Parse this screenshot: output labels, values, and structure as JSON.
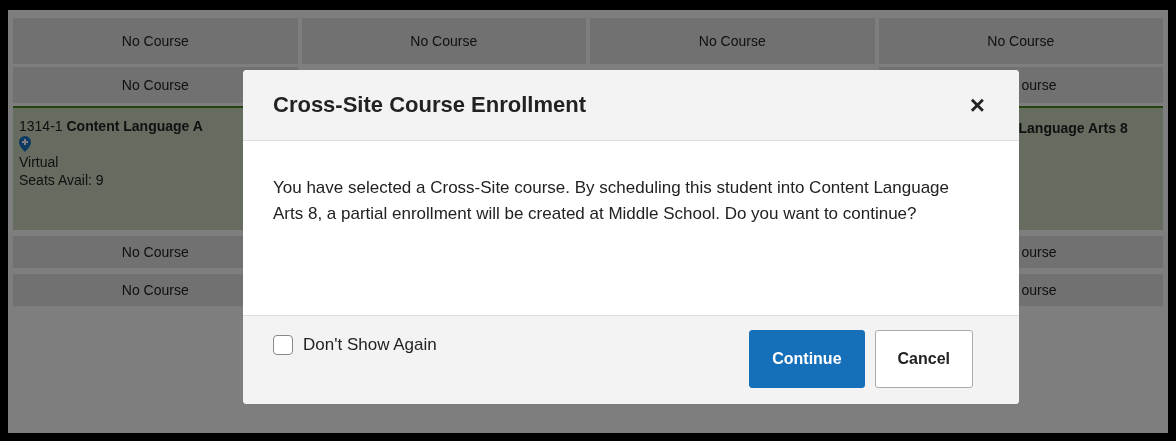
{
  "schedule": {
    "rows": [
      {
        "cells": [
          {
            "kind": "empty",
            "text": "No Course"
          },
          {
            "kind": "empty",
            "text": "No Course"
          },
          {
            "kind": "empty",
            "text": "No Course"
          },
          {
            "kind": "empty",
            "text": "No Course"
          }
        ]
      },
      {
        "cells": [
          {
            "kind": "empty",
            "text": "No Course"
          },
          null,
          null,
          {
            "kind": "cut",
            "text": "ourse"
          }
        ]
      },
      {
        "cells": [
          {
            "kind": "course",
            "code": "1314-1",
            "name": "Content Language A",
            "location": "Virtual",
            "seats": "Seats Avail: 9"
          },
          null,
          null,
          {
            "kind": "course-cut",
            "name": "Language Arts 8"
          }
        ]
      },
      {
        "cells": [
          {
            "kind": "empty",
            "text": "No Course"
          },
          null,
          null,
          {
            "kind": "cut",
            "text": "ourse"
          }
        ]
      },
      {
        "cells": [
          {
            "kind": "empty",
            "text": "No Course"
          },
          null,
          null,
          {
            "kind": "cut",
            "text": "ourse"
          }
        ]
      }
    ]
  },
  "dialog": {
    "title": "Cross-Site Course Enrollment",
    "close": "×",
    "message": "You have selected a Cross-Site course. By scheduling this student into Content Language Arts 8, a partial enrollment will be created at Middle School. Do you want to continue?",
    "dont_show_again": {
      "label": "Don't Show Again",
      "checked": false
    },
    "buttons": [
      "Continue",
      "Cancel"
    ]
  }
}
